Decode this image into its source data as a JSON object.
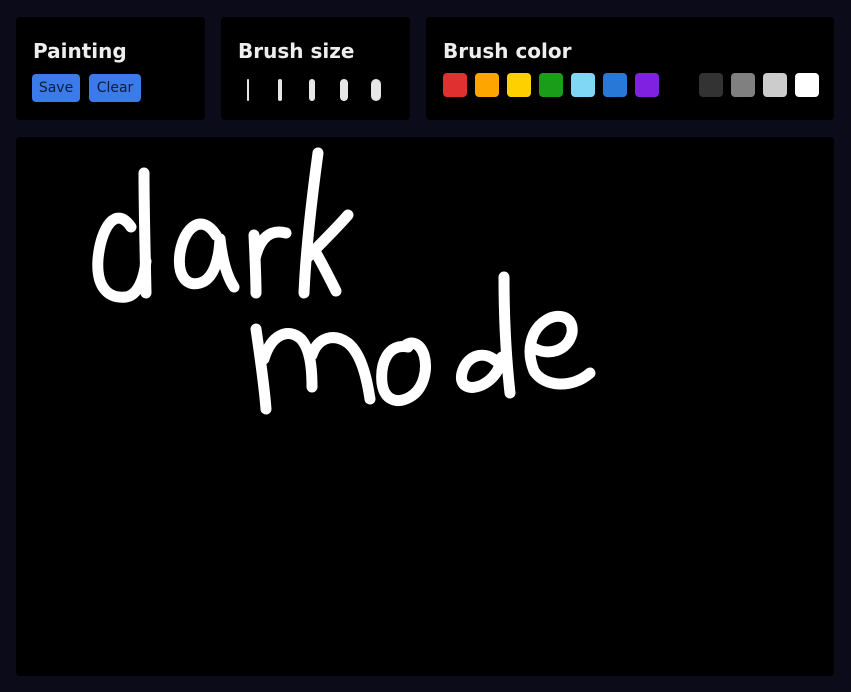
{
  "painting": {
    "title": "Painting",
    "save_label": "Save",
    "clear_label": "Clear",
    "button_color": "#3b7ae8"
  },
  "brush_size": {
    "title": "Brush size",
    "options": [
      1,
      2,
      3,
      4,
      5
    ],
    "selected": 5
  },
  "brush_color": {
    "title": "Brush color",
    "swatches": [
      {
        "name": "red",
        "color": "#e03030"
      },
      {
        "name": "orange",
        "color": "#ffa500"
      },
      {
        "name": "yellow",
        "color": "#ffd000"
      },
      {
        "name": "green",
        "color": "#1a9e1a"
      },
      {
        "name": "light-blue",
        "color": "#7fd6f5"
      },
      {
        "name": "blue",
        "color": "#2878d8"
      },
      {
        "name": "purple",
        "color": "#8020e0"
      },
      {
        "name": "dark-gray",
        "color": "#333333"
      },
      {
        "name": "gray",
        "color": "#808080"
      },
      {
        "name": "light-gray",
        "color": "#cccccc"
      },
      {
        "name": "white",
        "color": "#ffffff"
      }
    ],
    "selected": "white"
  },
  "canvas": {
    "background": "#000000",
    "stroke_color": "#ffffff"
  }
}
